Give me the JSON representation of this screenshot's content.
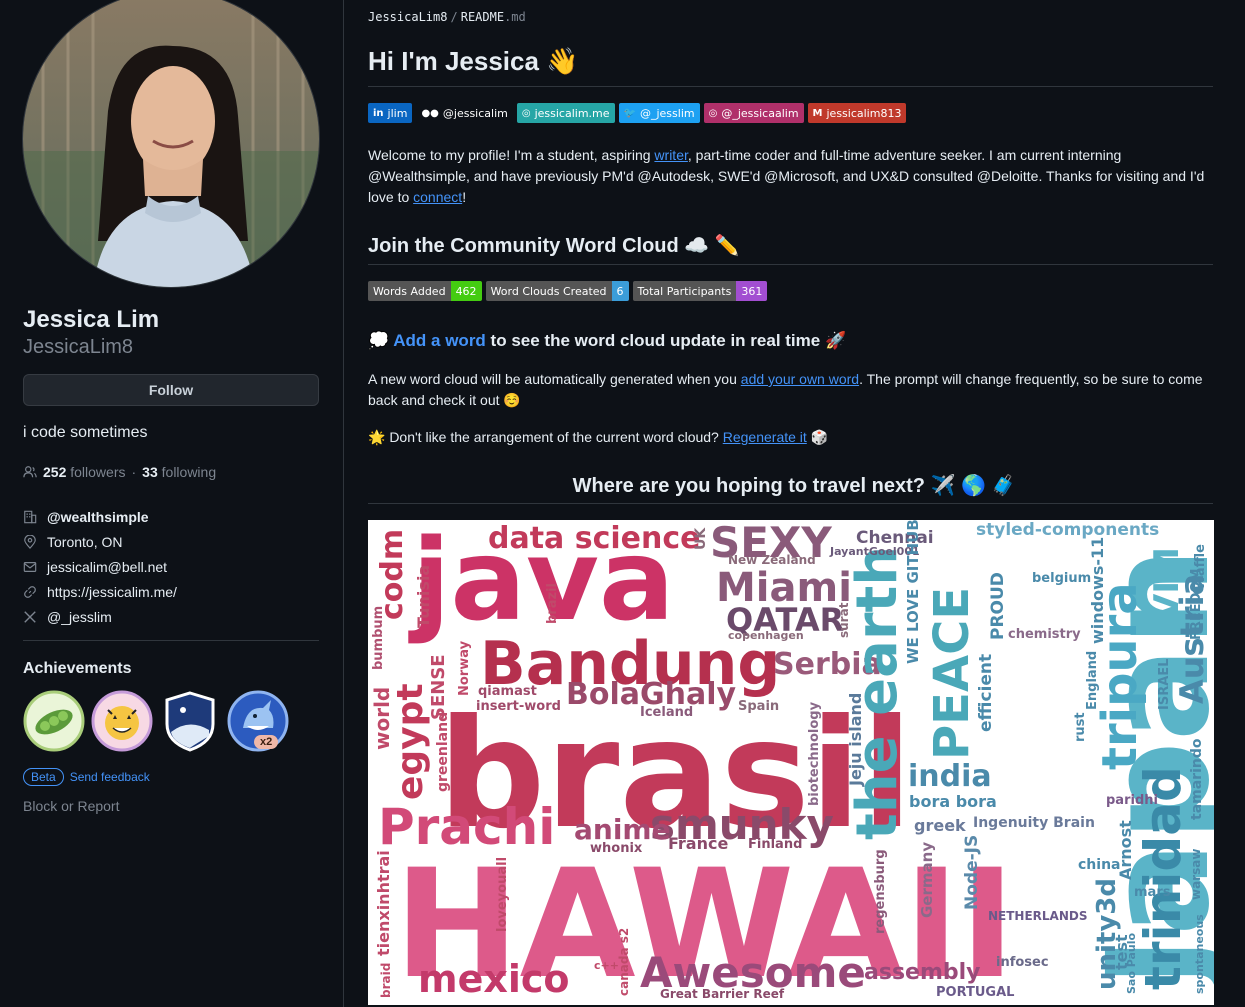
{
  "profile": {
    "name": "Jessica Lim",
    "login": "JessicaLim8",
    "follow_label": "Follow",
    "bio": "i code sometimes",
    "followers_count": "252",
    "followers_label": "followers",
    "separator": "·",
    "following_count": "33",
    "following_label": "following",
    "organization": "@wealthsimple",
    "location": "Toronto, ON",
    "email": "jessicalim@bell.net",
    "website": "https://jessicalim.me/",
    "x_handle": "@_jesslim",
    "achievements_title": "Achievements",
    "achievement_multiplier": "x2",
    "beta_label": "Beta",
    "feedback_label": "Send feedback",
    "block_label": "Block or Report"
  },
  "readme": {
    "owner": "JessicaLim8",
    "slash": "/",
    "file": "README",
    "ext": ".md",
    "heading": "Hi I'm Jessica 👋",
    "shields": [
      {
        "icon": "in",
        "label": "jlim",
        "color": "#0a66c2"
      },
      {
        "icon": "●●",
        "label": "@jessicalim",
        "color": "#0d1117"
      },
      {
        "icon": "◎",
        "label": "jessicalim.me",
        "color": "#26a6a6"
      },
      {
        "icon": "🐦",
        "label": "@_jesslim",
        "color": "#1da1f2"
      },
      {
        "icon": "◎",
        "label": "@_jessicaalim",
        "color": "#b0306a"
      },
      {
        "icon": "M",
        "label": "jessicalim813",
        "color": "#c0392b"
      }
    ],
    "intro_1": "Welcome to my profile! I'm a student, aspiring ",
    "intro_link_writer": "writer",
    "intro_2": ", part-time coder and full-time adventure seeker. I am current interning @Wealthsimple, and have previously PM'd @Autodesk, SWE'd @Microsoft, and UX&D consulted @Deloitte. Thanks for visiting and I'd love to ",
    "intro_link_connect": "connect",
    "intro_3": "!",
    "community_heading": "Join the Community Word Cloud ☁️ ✏️",
    "stats": [
      {
        "label": "Words Added",
        "value": "462",
        "color": "#4c1"
      },
      {
        "label": "Word Clouds Created",
        "value": "6",
        "color": "#3b9dd9"
      },
      {
        "label": "Total Participants",
        "value": "361",
        "color": "#a24ed1"
      }
    ],
    "add_word_prefix": "💭 ",
    "add_word_link": "Add a word",
    "add_word_suffix": " to see the word cloud update in real time 🚀",
    "new_cloud_1": "A new word cloud will be automatically generated when you ",
    "new_cloud_link": "add your own word",
    "new_cloud_2": ". The prompt will change frequently, so be sure to come back and check it out ☺️",
    "regen_1": "🌟 Don't like the arrangement of the current word cloud? ",
    "regen_link": "Regenerate it",
    "regen_2": " 🎲",
    "prompt": "Where are you hoping to travel next? ✈️ 🌎 🧳"
  },
  "cloud_words": [
    "java",
    "brasil",
    "HAWAII",
    "Japan",
    "Bandung",
    "Prachi",
    "data science",
    "SEXY",
    "Miami",
    "QATAR",
    "Serbia",
    "BolaGhaly",
    "smunky",
    "mexico",
    "Awesome",
    "the earth",
    "PEACE",
    "tripura",
    "trinidad",
    "india",
    "codm",
    "egypt",
    "VIM",
    "styled-components",
    "Chennai",
    "JayantGoel001",
    "New Zealand",
    "copenhagen",
    "surat",
    "UK",
    "brazil",
    "Tunisia",
    "bumbum",
    "world",
    "greenland",
    "SENSE",
    "Norway",
    "qiamast",
    "insert-word",
    "Iceland",
    "Spain",
    "anime",
    "whonix",
    "France",
    "Finland",
    "biotechnology",
    "Jeju island",
    "WE LOVE GITHUB",
    "efficient",
    "PROUD",
    "belgium",
    "chemistry",
    "windows-11",
    "England",
    "rust",
    "ISRAEL",
    "Austria",
    "FREEDOM",
    "Waffle",
    "bora bora",
    "greek",
    "Ingenuity Brain",
    "paridhi",
    "tamarindo",
    "tienxinhtrai",
    "loveyouall",
    "braid",
    "c++",
    "canada s2",
    "regensburg",
    "Germany",
    "Node-JS",
    "assembly",
    "Great Barrier Reef",
    "NETHERLANDS",
    "infosec",
    "PORTUGAL",
    "unity3d",
    "test",
    "Sao Paulo",
    "Arnost",
    "mars",
    "china",
    "warsaw",
    "spontaneous"
  ]
}
